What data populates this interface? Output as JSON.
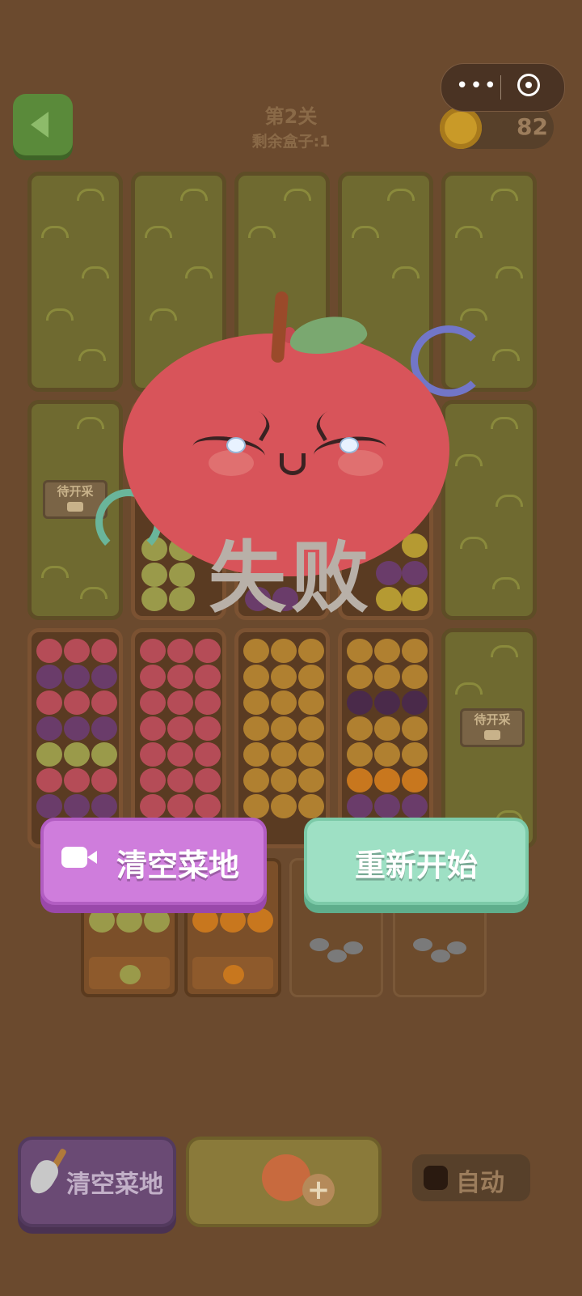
{
  "header": {
    "level_title": "第2关",
    "boxes_remaining": "剩余盒子:1",
    "coins": "82"
  },
  "mini_program_capsule": {
    "more_glyph": "•••"
  },
  "locked_plot_label": "待开采",
  "fail_overlay": {
    "title": "失败",
    "clear_field_button": "清空菜地",
    "restart_button": "重新开始"
  },
  "bottom_bar": {
    "clear_field_label": "清空菜地",
    "auto_label": "自动",
    "add_plus": "+"
  },
  "colors": {
    "background": "#6b4a2e",
    "clear_button": "#cf7ddc",
    "restart_button": "#9ee0c4",
    "apple": "#d8545a"
  }
}
